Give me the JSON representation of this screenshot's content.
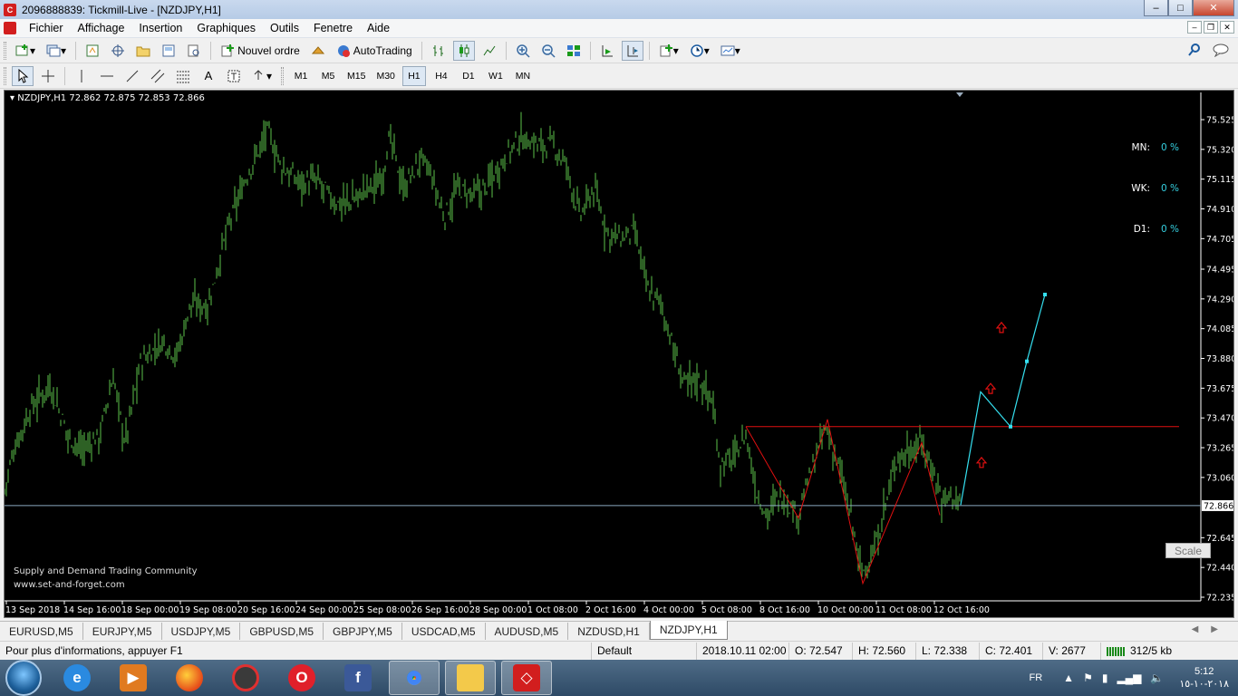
{
  "window": {
    "title": "2096888839: Tickmill-Live - [NZDJPY,H1]"
  },
  "menu": [
    "Fichier",
    "Affichage",
    "Insertion",
    "Graphiques",
    "Outils",
    "Fenetre",
    "Aide"
  ],
  "toolbar": {
    "new_order": "Nouvel ordre",
    "autotrading": "AutoTrading"
  },
  "timeframes": [
    "M1",
    "M5",
    "M15",
    "M30",
    "H1",
    "H4",
    "D1",
    "W1",
    "MN"
  ],
  "active_timeframe": "H1",
  "chart": {
    "symbol_line": "NZDJPY,H1  72.862 72.875 72.853 72.866",
    "current_price_label": "72.866",
    "stats": [
      {
        "label": "MN:",
        "value": "0 %"
      },
      {
        "label": "WK:",
        "value": "0 %"
      },
      {
        "label": "D1:",
        "value": "0 %"
      }
    ],
    "watermark": [
      "Supply and Demand Trading Community",
      "www.set-and-forget.com"
    ],
    "scale_button": "Scale",
    "colors": {
      "background": "#000000",
      "bars": "#5cc24a",
      "zigzag": "#e01010",
      "projection": "#35e0f0",
      "arrow": "#e01010"
    }
  },
  "chart_data": {
    "type": "bar",
    "symbol": "NZDJPY",
    "timeframe": "H1",
    "price_axis": {
      "ticks": [
        "75.525",
        "75.320",
        "75.115",
        "74.910",
        "74.705",
        "74.495",
        "74.290",
        "74.085",
        "73.880",
        "73.675",
        "73.470",
        "73.265",
        "73.060",
        "72.866",
        "72.645",
        "72.440",
        "72.235"
      ],
      "ylim": [
        72.235,
        75.525
      ]
    },
    "time_axis": {
      "ticks": [
        "13 Sep 2018",
        "14 Sep 16:00",
        "18 Sep 00:00",
        "19 Sep 08:00",
        "20 Sep 16:00",
        "24 Sep 00:00",
        "25 Sep 08:00",
        "26 Sep 16:00",
        "28 Sep 00:00",
        "1 Oct 08:00",
        "2 Oct 16:00",
        "4 Oct 00:00",
        "5 Oct 08:00",
        "8 Oct 16:00",
        "10 Oct 00:00",
        "11 Oct 08:00",
        "12 Oct 16:00"
      ]
    },
    "price_path": [
      {
        "x": 0,
        "y": 72.97
      },
      {
        "x": 10,
        "y": 73.25
      },
      {
        "x": 30,
        "y": 73.55
      },
      {
        "x": 50,
        "y": 73.7
      },
      {
        "x": 70,
        "y": 73.35
      },
      {
        "x": 85,
        "y": 73.25
      },
      {
        "x": 105,
        "y": 73.35
      },
      {
        "x": 120,
        "y": 73.75
      },
      {
        "x": 133,
        "y": 73.3
      },
      {
        "x": 150,
        "y": 73.85
      },
      {
        "x": 175,
        "y": 74.0
      },
      {
        "x": 190,
        "y": 73.9
      },
      {
        "x": 205,
        "y": 74.25
      },
      {
        "x": 225,
        "y": 74.25
      },
      {
        "x": 245,
        "y": 74.75
      },
      {
        "x": 265,
        "y": 75.1
      },
      {
        "x": 290,
        "y": 75.45
      },
      {
        "x": 305,
        "y": 75.2
      },
      {
        "x": 325,
        "y": 75.1
      },
      {
        "x": 345,
        "y": 75.1
      },
      {
        "x": 365,
        "y": 74.95
      },
      {
        "x": 380,
        "y": 74.95
      },
      {
        "x": 400,
        "y": 75.05
      },
      {
        "x": 415,
        "y": 75.1
      },
      {
        "x": 425,
        "y": 75.4
      },
      {
        "x": 440,
        "y": 75.05
      },
      {
        "x": 460,
        "y": 75.25
      },
      {
        "x": 470,
        "y": 75.15
      },
      {
        "x": 485,
        "y": 74.85
      },
      {
        "x": 500,
        "y": 75.05
      },
      {
        "x": 515,
        "y": 75.0
      },
      {
        "x": 530,
        "y": 75.05
      },
      {
        "x": 550,
        "y": 75.25
      },
      {
        "x": 570,
        "y": 75.4
      },
      {
        "x": 590,
        "y": 75.35
      },
      {
        "x": 605,
        "y": 75.35
      },
      {
        "x": 620,
        "y": 75.2
      },
      {
        "x": 635,
        "y": 74.85
      },
      {
        "x": 650,
        "y": 75.05
      },
      {
        "x": 665,
        "y": 74.75
      },
      {
        "x": 680,
        "y": 74.7
      },
      {
        "x": 695,
        "y": 74.75
      },
      {
        "x": 710,
        "y": 74.35
      },
      {
        "x": 725,
        "y": 74.25
      },
      {
        "x": 740,
        "y": 73.9
      },
      {
        "x": 750,
        "y": 73.7
      },
      {
        "x": 765,
        "y": 73.75
      },
      {
        "x": 780,
        "y": 73.6
      },
      {
        "x": 790,
        "y": 73.15
      },
      {
        "x": 805,
        "y": 73.2
      },
      {
        "x": 818,
        "y": 73.35
      },
      {
        "x": 830,
        "y": 72.95
      },
      {
        "x": 842,
        "y": 72.8
      },
      {
        "x": 855,
        "y": 72.95
      },
      {
        "x": 875,
        "y": 72.8
      },
      {
        "x": 890,
        "y": 73.1
      },
      {
        "x": 906,
        "y": 73.4
      },
      {
        "x": 920,
        "y": 73.15
      },
      {
        "x": 935,
        "y": 72.75
      },
      {
        "x": 946,
        "y": 72.4
      },
      {
        "x": 960,
        "y": 72.55
      },
      {
        "x": 975,
        "y": 72.95
      },
      {
        "x": 985,
        "y": 73.2
      },
      {
        "x": 1000,
        "y": 73.25
      },
      {
        "x": 1012,
        "y": 73.3
      },
      {
        "x": 1025,
        "y": 73.1
      },
      {
        "x": 1035,
        "y": 72.9
      },
      {
        "x": 1045,
        "y": 72.95
      },
      {
        "x": 1055,
        "y": 72.87
      }
    ],
    "current_price": 72.866,
    "resistance_level": 73.41,
    "annotations": [
      {
        "type": "zigzag",
        "points": [
          {
            "x": 818,
            "y": 73.41
          },
          {
            "x": 876,
            "y": 72.78
          },
          {
            "x": 908,
            "y": 73.46
          },
          {
            "x": 947,
            "y": 72.33
          },
          {
            "x": 1012,
            "y": 73.3
          },
          {
            "x": 1032,
            "y": 72.8
          }
        ]
      },
      {
        "type": "projection",
        "points": [
          {
            "x": 1055,
            "y": 72.87
          },
          {
            "x": 1077,
            "y": 73.65
          },
          {
            "x": 1110,
            "y": 73.41
          },
          {
            "x": 1128,
            "y": 73.86
          },
          {
            "x": 1148,
            "y": 74.32
          }
        ]
      },
      {
        "type": "up-arrow",
        "points": [
          {
            "x": 1078,
            "y": 73.16
          },
          {
            "x": 1088,
            "y": 73.67
          },
          {
            "x": 1100,
            "y": 74.09
          }
        ]
      }
    ]
  },
  "tabs": [
    "EURUSD,M5",
    "EURJPY,M5",
    "USDJPY,M5",
    "GBPUSD,M5",
    "GBPJPY,M5",
    "USDCAD,M5",
    "AUDUSD,M5",
    "NZDUSD,H1",
    "NZDJPY,H1"
  ],
  "active_tab": "NZDJPY,H1",
  "status": {
    "help": "Pour plus d'informations, appuyer F1",
    "profile": "Default",
    "datetime": "2018.10.11 02:00",
    "open": "O: 72.547",
    "high": "H: 72.560",
    "low": "L: 72.338",
    "close": "C: 72.401",
    "volume": "V: 2677",
    "traffic": "312/5 kb"
  },
  "taskbar": {
    "apps": [
      "internet-explorer",
      "media-player",
      "firefox",
      "app-bird",
      "opera",
      "facebook",
      "chrome",
      "file-explorer",
      "metatrader"
    ],
    "lang": "FR",
    "time": "5:12",
    "date": "٢٠١٨-١٠-١٥"
  }
}
